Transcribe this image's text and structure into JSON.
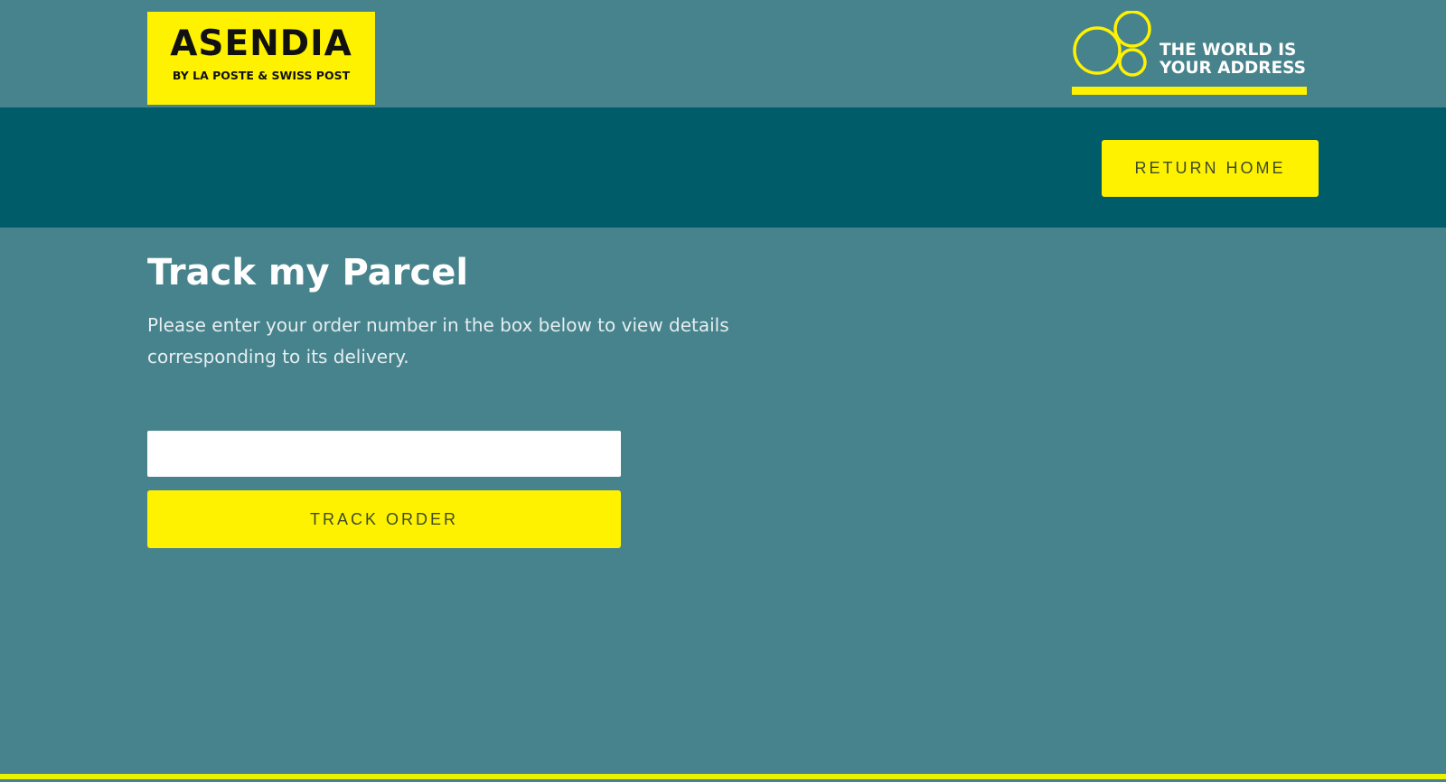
{
  "brand": {
    "logo_title": "ASENDIA",
    "logo_subtitle": "BY LA POSTE & SWISS POST",
    "tagline_line1": "THE WORLD IS",
    "tagline_line2": "YOUR ADDRESS"
  },
  "nav": {
    "return_home_label": "RETURN HOME"
  },
  "main": {
    "title": "Track my Parcel",
    "intro": "Please enter your order number in the box below to view details corresponding to its delivery.",
    "order_input_value": "",
    "order_input_placeholder": "",
    "track_button_label": "TRACK ORDER"
  },
  "colors": {
    "background": "#46838c",
    "nav_band": "#005c69",
    "accent_yellow": "#fff200",
    "button_text": "#3d4b2b",
    "white": "#ffffff"
  },
  "icons": {
    "tagline_graphic": "circles-icon"
  }
}
